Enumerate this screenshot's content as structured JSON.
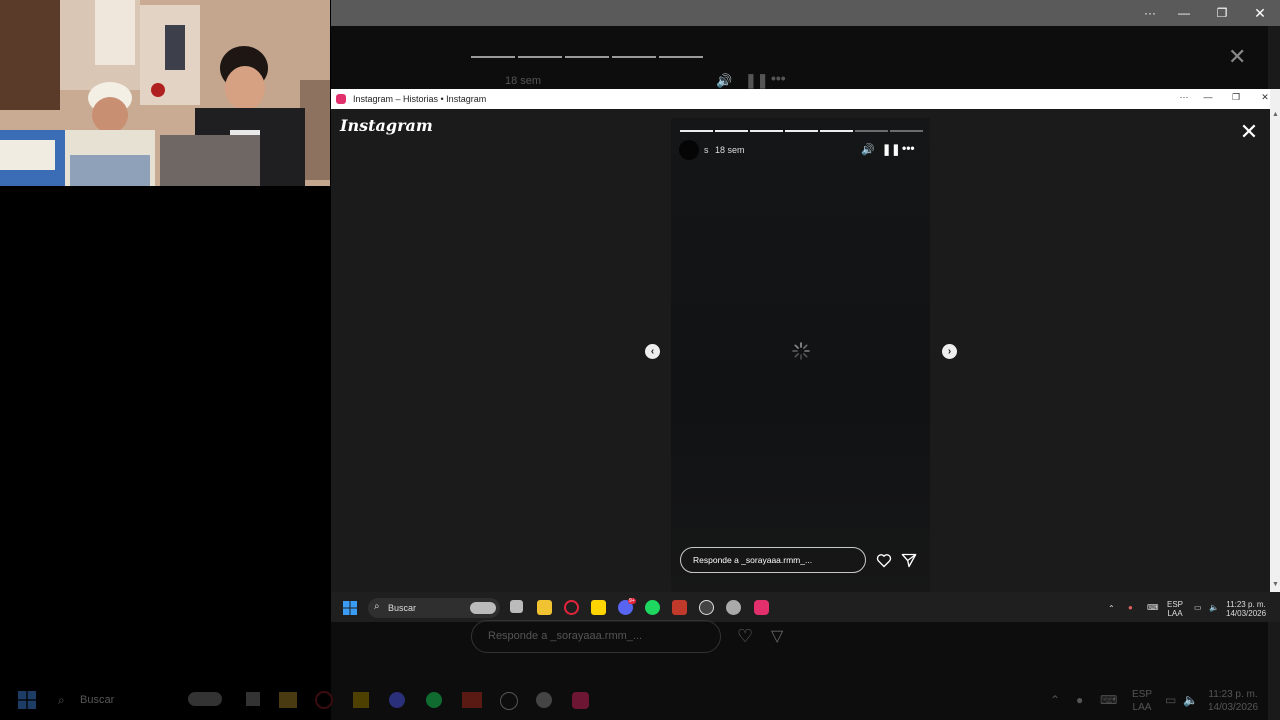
{
  "background_window": {
    "time_label": "18 sem",
    "reply_placeholder": "Responde a _sorayaaa.rmm_...",
    "taskbar_search": "Buscar",
    "lang": "ESP",
    "layout": "LAA",
    "clock_time": "11:23 p. m.",
    "clock_date": "14/03/2026"
  },
  "window": {
    "title": "Instagram – Historias • Instagram"
  },
  "app": {
    "logo": "Instagram"
  },
  "story": {
    "username_initial": "s",
    "time_ago": "18 sem",
    "segments_total": 7,
    "segments_done": 5,
    "reply_placeholder": "Responde a _sorayaaa.rmm_..."
  },
  "taskbar": {
    "search_label": "Buscar",
    "lang": "ESP",
    "layout": "LAA",
    "time": "11:23 p. m.",
    "date": "14/03/2026",
    "discord_badge": "9+",
    "apps": [
      "file-explorer-icon",
      "opera-icon",
      "sticky-notes-icon",
      "discord-icon",
      "spotify-icon",
      "voicemeeter-icon",
      "chrome-icon",
      "obs-icon",
      "instagram-icon"
    ]
  },
  "colors": {
    "accent_instagram": "#e1306c",
    "spotify": "#1ed760",
    "discord": "#5865f2",
    "windows_blue": "#3b9cf5"
  }
}
